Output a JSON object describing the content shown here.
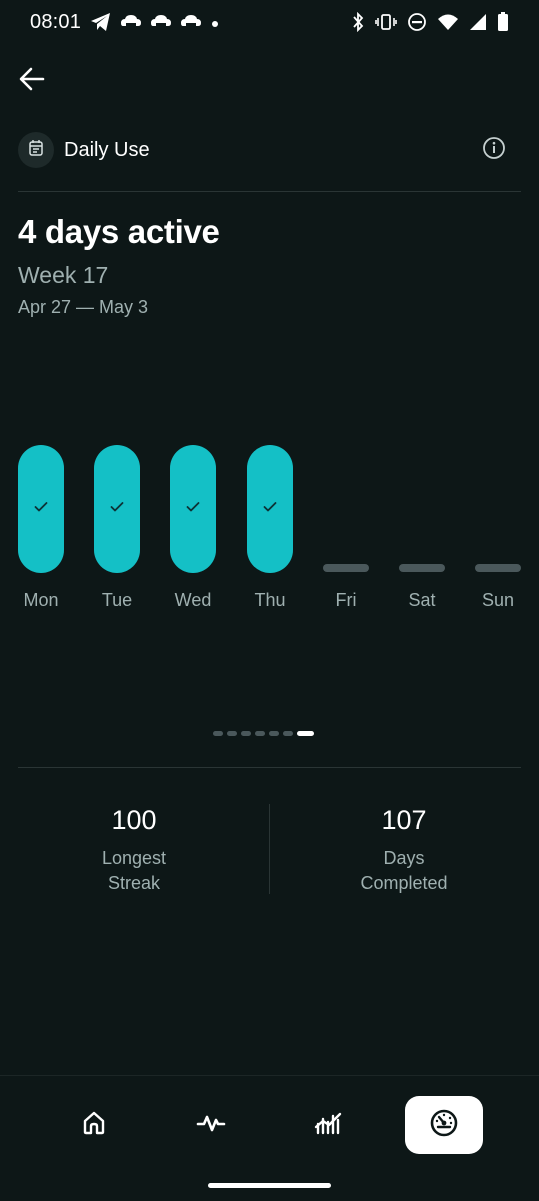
{
  "status_bar": {
    "time": "08:01",
    "left_icons": [
      "telegram-icon",
      "cloud-app-icon",
      "cloud-app-icon",
      "cloud-app-icon",
      "notification-dot-icon"
    ],
    "right_icons": [
      "bluetooth-icon",
      "vibrate-icon",
      "do-not-disturb-icon",
      "wifi-icon",
      "signal-icon",
      "battery-icon"
    ]
  },
  "header": {
    "title": "Daily Use",
    "icon": "calendar-icon",
    "info_icon": "info-icon"
  },
  "summary": {
    "headline": "4 days active",
    "week": "Week 17",
    "date_range": "Apr 27 — May 3"
  },
  "week_days": [
    {
      "label": "Mon",
      "completed": true
    },
    {
      "label": "Tue",
      "completed": true
    },
    {
      "label": "Wed",
      "completed": true
    },
    {
      "label": "Thu",
      "completed": true
    },
    {
      "label": "Fri",
      "completed": false
    },
    {
      "label": "Sat",
      "completed": false
    },
    {
      "label": "Sun",
      "completed": false
    }
  ],
  "pagination": {
    "total_pages": 7,
    "active_page": 7
  },
  "stats": {
    "longest_streak": {
      "value": "100",
      "label_line1": "Longest",
      "label_line2": "Streak"
    },
    "days_completed": {
      "value": "107",
      "label_line1": "Days",
      "label_line2": "Completed"
    }
  },
  "bottom_nav": [
    {
      "icon": "home-icon",
      "active": false
    },
    {
      "icon": "activity-pulse-icon",
      "active": false
    },
    {
      "icon": "trends-chart-icon",
      "active": false
    },
    {
      "icon": "dashboard-gauge-icon",
      "active": true
    }
  ],
  "colors": {
    "background": "#0d1717",
    "accent": "#14c0c6",
    "muted_text": "#9fb0b0",
    "inactive_bar": "#4a585b"
  }
}
